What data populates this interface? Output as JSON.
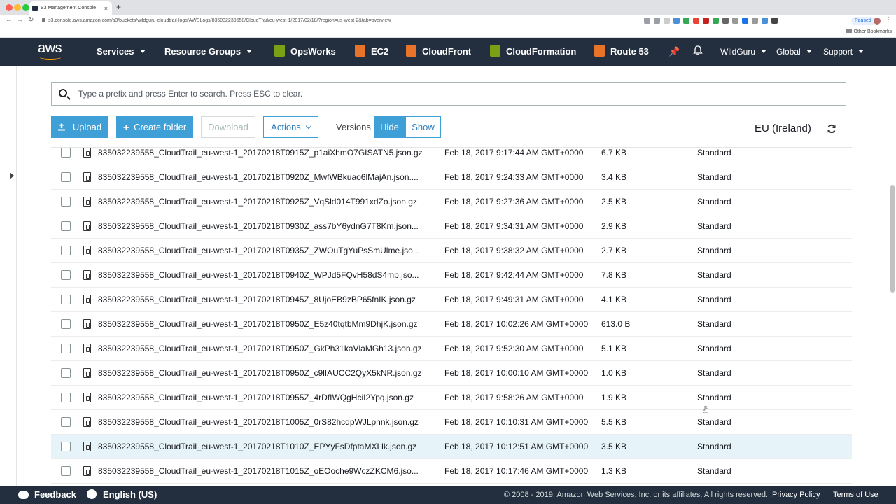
{
  "browser": {
    "tab_title": "S3 Management Console",
    "url": "s3.console.aws.amazon.com/s3/buckets/wildguru-cloudtrail-logs/AWSLogs/835032239558/CloudTrail/eu-west-1/2017/02/18/?region=us-west-2&tab=overview",
    "paused_label": "Paused",
    "other_bookmarks": "Other Bookmarks"
  },
  "nav": {
    "logo": "aws",
    "services": "Services",
    "resource_groups": "Resource Groups",
    "shortcuts": [
      {
        "label": "OpsWorks",
        "color": "#7aa116"
      },
      {
        "label": "EC2",
        "color": "#e8742a"
      },
      {
        "label": "CloudFront",
        "color": "#e8742a"
      },
      {
        "label": "CloudFormation",
        "color": "#7aa116"
      },
      {
        "label": "Route 53",
        "color": "#e8742a"
      }
    ],
    "account": "WildGuru",
    "region_menu": "Global",
    "support": "Support"
  },
  "search": {
    "placeholder": "Type a prefix and press Enter to search. Press ESC to clear."
  },
  "toolbar": {
    "upload": "Upload",
    "create_folder": "Create folder",
    "download": "Download",
    "actions": "Actions",
    "versions_label": "Versions",
    "hide": "Hide",
    "show": "Show",
    "region": "EU (Ireland)"
  },
  "files": [
    {
      "name": "835032239558_CloudTrail_eu-west-1_20170218T0915Z_p1aiXhmO7GISATN5.json.gz",
      "date": "Feb 18, 2017 9:17:44 AM GMT+0000",
      "size": "6.7 KB",
      "storage": "Standard"
    },
    {
      "name": "835032239558_CloudTrail_eu-west-1_20170218T0920Z_MwfWBkuao6lMajAn.json....",
      "date": "Feb 18, 2017 9:24:33 AM GMT+0000",
      "size": "3.4 KB",
      "storage": "Standard"
    },
    {
      "name": "835032239558_CloudTrail_eu-west-1_20170218T0925Z_VqSld014T991xdZo.json.gz",
      "date": "Feb 18, 2017 9:27:36 AM GMT+0000",
      "size": "2.5 KB",
      "storage": "Standard"
    },
    {
      "name": "835032239558_CloudTrail_eu-west-1_20170218T0930Z_ass7bY6ydnG7T8Km.json...",
      "date": "Feb 18, 2017 9:34:31 AM GMT+0000",
      "size": "2.9 KB",
      "storage": "Standard"
    },
    {
      "name": "835032239558_CloudTrail_eu-west-1_20170218T0935Z_ZWOuTgYuPsSmUlme.jso...",
      "date": "Feb 18, 2017 9:38:32 AM GMT+0000",
      "size": "2.7 KB",
      "storage": "Standard"
    },
    {
      "name": "835032239558_CloudTrail_eu-west-1_20170218T0940Z_WPJd5FQvH58dS4mp.jso...",
      "date": "Feb 18, 2017 9:42:44 AM GMT+0000",
      "size": "7.8 KB",
      "storage": "Standard"
    },
    {
      "name": "835032239558_CloudTrail_eu-west-1_20170218T0945Z_8UjoEB9zBP65fnIK.json.gz",
      "date": "Feb 18, 2017 9:49:31 AM GMT+0000",
      "size": "4.1 KB",
      "storage": "Standard"
    },
    {
      "name": "835032239558_CloudTrail_eu-west-1_20170218T0950Z_E5z40tqtbMm9DhjK.json.gz",
      "date": "Feb 18, 2017 10:02:26 AM GMT+0000",
      "size": "613.0 B",
      "storage": "Standard"
    },
    {
      "name": "835032239558_CloudTrail_eu-west-1_20170218T0950Z_GkPh31kaVlaMGh13.json.gz",
      "date": "Feb 18, 2017 9:52:30 AM GMT+0000",
      "size": "5.1 KB",
      "storage": "Standard"
    },
    {
      "name": "835032239558_CloudTrail_eu-west-1_20170218T0950Z_c9lIAUCC2QyX5kNR.json.gz",
      "date": "Feb 18, 2017 10:00:10 AM GMT+0000",
      "size": "1.0 KB",
      "storage": "Standard"
    },
    {
      "name": "835032239558_CloudTrail_eu-west-1_20170218T0955Z_4rDfIWQgHciI2Ypq.json.gz",
      "date": "Feb 18, 2017 9:58:26 AM GMT+0000",
      "size": "1.9 KB",
      "storage": "Standard"
    },
    {
      "name": "835032239558_CloudTrail_eu-west-1_20170218T1005Z_0rS82hcdpWJLpnnk.json.gz",
      "date": "Feb 18, 2017 10:10:31 AM GMT+0000",
      "size": "5.5 KB",
      "storage": "Standard"
    },
    {
      "name": "835032239558_CloudTrail_eu-west-1_20170218T1010Z_EPYyFsDfptaMXLlk.json.gz",
      "date": "Feb 18, 2017 10:12:51 AM GMT+0000",
      "size": "3.5 KB",
      "storage": "Standard",
      "highlighted": true
    },
    {
      "name": "835032239558_CloudTrail_eu-west-1_20170218T1015Z_oEOoche9WczZKCM6.jso...",
      "date": "Feb 18, 2017 10:17:46 AM GMT+0000",
      "size": "1.3 KB",
      "storage": "Standard"
    }
  ],
  "footer": {
    "feedback": "Feedback",
    "language": "English (US)",
    "copyright": "© 2008 - 2019, Amazon Web Services, Inc. or its affiliates. All rights reserved.",
    "privacy": "Privacy Policy",
    "terms": "Terms of Use"
  },
  "colors": {
    "aws_nav": "#232f3e",
    "primary_button": "#3f9fd7",
    "row_highlight": "#e6f3f8",
    "aws_orange": "#ff9900"
  }
}
